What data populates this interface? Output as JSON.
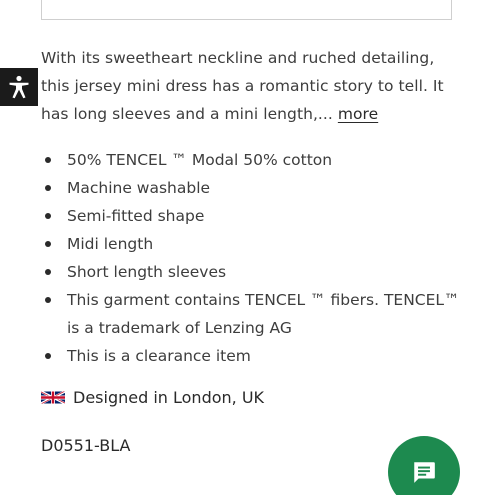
{
  "description": {
    "text": "With its sweetheart neckline and ruched detailing, this jersey mini dress has a romantic story to tell. It has long sleeves and a mini length,...",
    "more_link": "more"
  },
  "features": [
    "50% TENCEL ™ Modal 50% cotton",
    "Machine washable",
    "Semi-fitted shape",
    "Midi length",
    "Short length sleeves",
    "This garment contains TENCEL ™ fibers. TENCEL™ is a trademark of Lenzing AG",
    "This is a clearance item"
  ],
  "origin": {
    "flag_icon": "uk-flag-icon",
    "label": "Designed in London, UK"
  },
  "sku": "D0551-BLA",
  "accessibility_button": {
    "icon": "accessibility-icon"
  },
  "chat_button": {
    "icon": "chat-icon",
    "color": "#1d8a4f"
  }
}
